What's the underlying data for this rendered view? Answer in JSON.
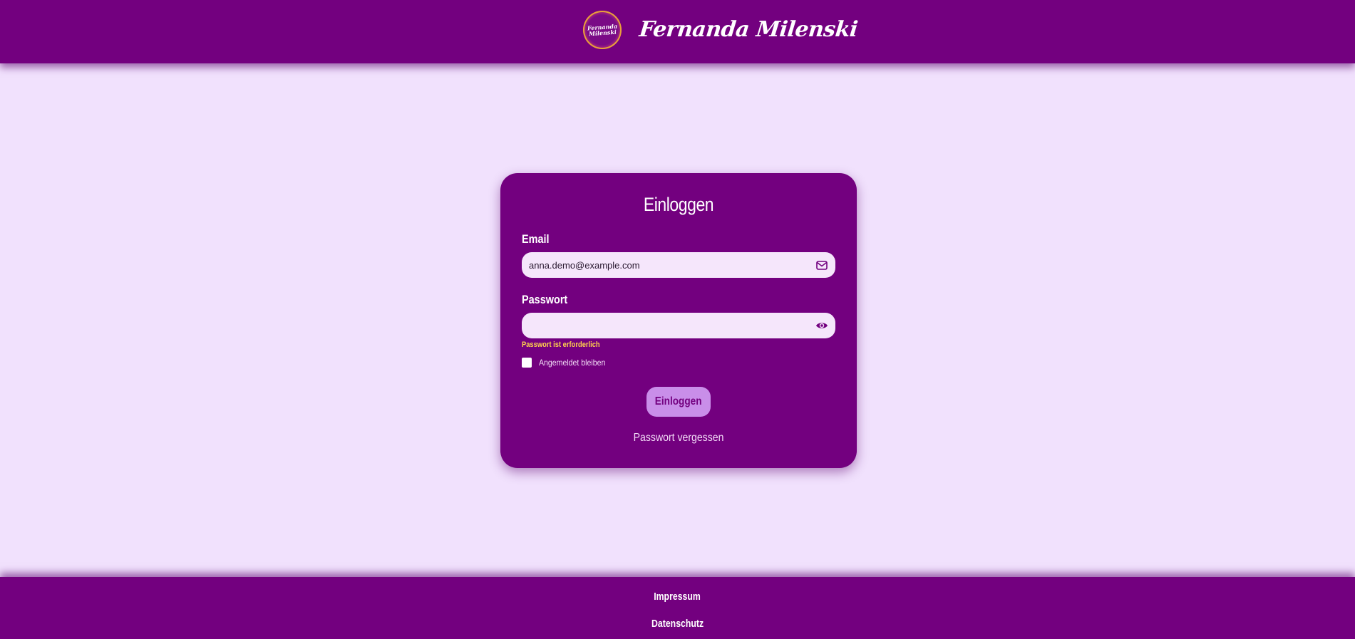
{
  "header": {
    "logo_lines": [
      "Fernanda",
      "Milenski"
    ],
    "brand_name": "Fernanda Milenski"
  },
  "login": {
    "title": "Einloggen",
    "email_label": "Email",
    "email_value": "anna.demo@example.com",
    "email_icon": "mail-icon",
    "password_label": "Passwort",
    "password_value": "",
    "password_icon": "eye-icon",
    "password_error": "Passwort ist erforderlich",
    "remember_label": "Angemeldet bleiben",
    "remember_checked": false,
    "submit_label": "Einloggen",
    "forgot_label": "Passwort vergessen"
  },
  "footer": {
    "impressum": "Impressum",
    "datenschutz": "Datenschutz"
  },
  "colors": {
    "primary": "#73007f",
    "background": "#f1e1fd",
    "button": "#c98ee9",
    "error": "#ffd34d"
  }
}
